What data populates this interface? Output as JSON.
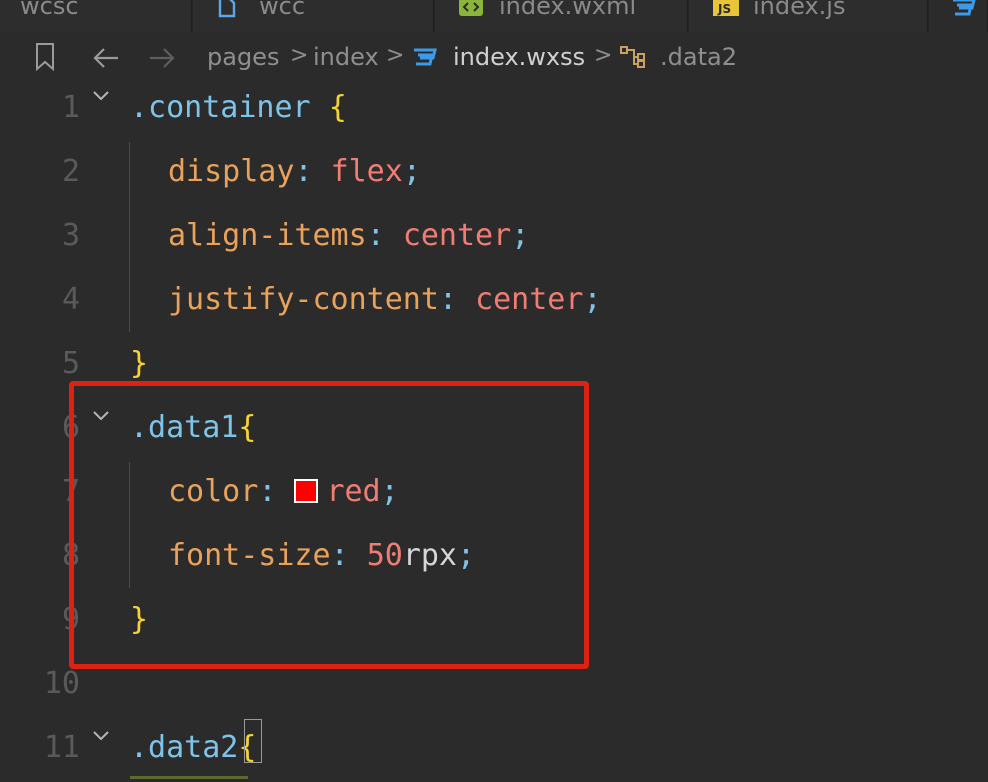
{
  "tabs": [
    {
      "label": "wcsc",
      "icon": "none"
    },
    {
      "label": "wcc",
      "icon": "file-icon"
    },
    {
      "label": "index.wxml",
      "icon": "wxml-icon"
    },
    {
      "label": "index.js",
      "icon": "js-icon",
      "icon_text": "JS"
    },
    {
      "label": "",
      "icon": "css-icon"
    }
  ],
  "breadcrumb": {
    "items": [
      "pages",
      "index",
      "index.wxss",
      ".data2"
    ],
    "separator": ">"
  },
  "editor": {
    "lines": [
      {
        "num": "1",
        "fold": true
      },
      {
        "num": "2"
      },
      {
        "num": "3"
      },
      {
        "num": "4"
      },
      {
        "num": "5"
      },
      {
        "num": "6",
        "fold": true
      },
      {
        "num": "7"
      },
      {
        "num": "8"
      },
      {
        "num": "9"
      },
      {
        "num": "10"
      },
      {
        "num": "11",
        "fold": true
      }
    ],
    "code": {
      "l1_sel": ".container",
      "l1_brace": "{",
      "l2_prop": "display",
      "l2_val": "flex",
      "l3_prop": "align-items",
      "l3_val": "center",
      "l4_prop": "justify-content",
      "l4_val": "center",
      "l5_brace": "}",
      "l6_sel": ".data1",
      "l6_brace": "{",
      "l7_prop": "color",
      "l7_val": "red",
      "l8_prop": "font-size",
      "l8_num": "50",
      "l8_unit": "rpx",
      "l9_brace": "}",
      "l11_sel": ".data2",
      "l11_brace": "{",
      "colon": ":",
      "semi": ";"
    },
    "colors": {
      "selector": "#7fc4e8",
      "brace": "#f5d238",
      "property": "#e9a25c",
      "value": "#f07d74",
      "swatch": "#ff0000",
      "highlight_box": "#dd2214"
    }
  }
}
